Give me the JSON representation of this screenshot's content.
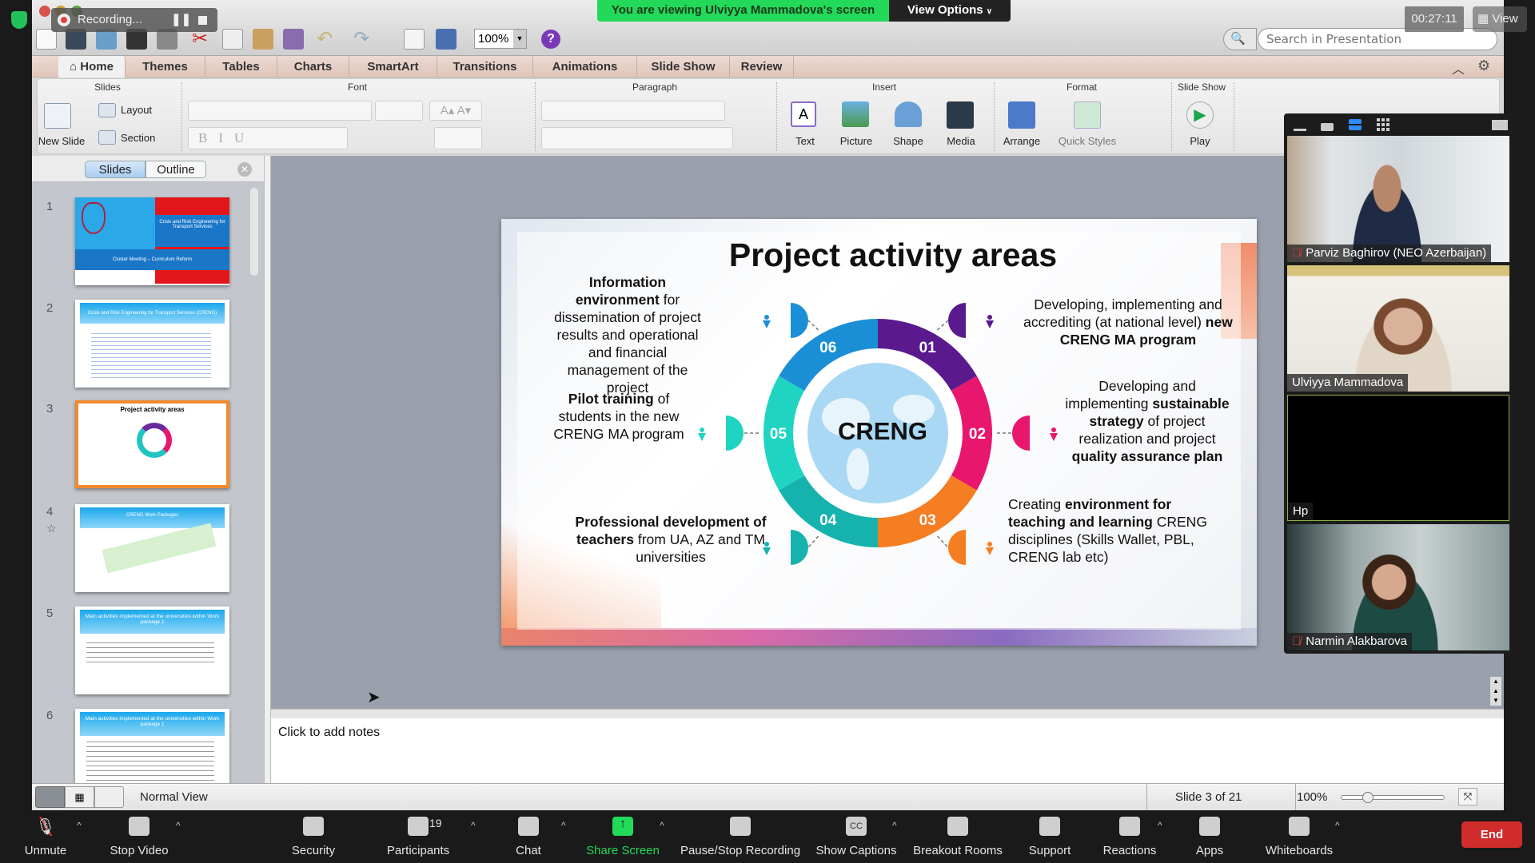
{
  "zoom_meeting": {
    "recording_label": "Recording...",
    "share_banner": "You are viewing Ulviyya Mammadova's screen",
    "view_options": "View Options",
    "timer": "00:27:11",
    "view_label": "View",
    "toolbar": [
      {
        "label": "Unmute",
        "icon": "microphone-muted-icon"
      },
      {
        "label": "Stop Video",
        "icon": "video-camera-icon"
      },
      {
        "label": "Security",
        "icon": "shield-icon"
      },
      {
        "label": "Participants",
        "icon": "participants-icon",
        "count": "19"
      },
      {
        "label": "Chat",
        "icon": "chat-bubble-icon"
      },
      {
        "label": "Share Screen",
        "icon": "share-screen-icon"
      },
      {
        "label": "Pause/Stop Recording",
        "icon": "pause-stop-icon"
      },
      {
        "label": "Show Captions",
        "icon": "cc-icon",
        "glyph": "CC"
      },
      {
        "label": "Breakout Rooms",
        "icon": "breakout-rooms-icon"
      },
      {
        "label": "Support",
        "icon": "support-icon"
      },
      {
        "label": "Reactions",
        "icon": "reactions-icon"
      },
      {
        "label": "Apps",
        "icon": "apps-icon"
      },
      {
        "label": "Whiteboards",
        "icon": "whiteboard-icon"
      }
    ],
    "end_label": "End",
    "share_color": "#23d959",
    "end_color": "#d12c2c",
    "participants": [
      {
        "name": "Parviz Baghirov (NEO Azerbaijan)",
        "muted": true
      },
      {
        "name": "Ulviyya Mammadova",
        "muted": false
      },
      {
        "name": "Hp",
        "muted": false
      },
      {
        "name": "Narmin Alakbarova",
        "muted": true
      }
    ]
  },
  "app": {
    "zoom_level": "100%",
    "search_placeholder": "Search in Presentation",
    "tabs": [
      "Home",
      "Themes",
      "Tables",
      "Charts",
      "SmartArt",
      "Transitions",
      "Animations",
      "Slide Show",
      "Review"
    ],
    "ribbon": {
      "groups": [
        "Slides",
        "Font",
        "Paragraph",
        "Insert",
        "Format",
        "Slide Show"
      ],
      "new_slide": "New Slide",
      "layout": "Layout",
      "section": "Section",
      "insert": [
        "Text",
        "Picture",
        "Shape",
        "Media"
      ],
      "format": [
        "Arrange",
        "Quick Styles"
      ],
      "play": "Play"
    },
    "panel_tabs": [
      "Slides",
      "Outline"
    ],
    "thumbnails": [
      {
        "num": "1",
        "title": "Crisis and Risk Engineering for Transport Services",
        "subtitle": "Cluster Meeting – Curriculum Reform"
      },
      {
        "num": "2",
        "title": "Crisis and Risk Engineering for Transport Services (CRENG)"
      },
      {
        "num": "3",
        "title": "Project activity areas"
      },
      {
        "num": "4",
        "title": "CRENG Work Packages"
      },
      {
        "num": "5",
        "title": "Main activities implemented at the universities within Work package 1"
      },
      {
        "num": "6",
        "title": "Main activities implemented at the universities within Work package 1"
      }
    ],
    "notes_placeholder": "Click to add notes",
    "status": {
      "view": "Normal View",
      "slide_info": "Slide 3 of 21",
      "zoom": "100%",
      "zoom_slider_fraction": 0.25
    }
  },
  "slide": {
    "title": "Project activity areas",
    "center": "CRENG",
    "segments": [
      {
        "num": "01",
        "color": "#5a1a8e"
      },
      {
        "num": "02",
        "color": "#e8166d"
      },
      {
        "num": "03",
        "color": "#f57d22"
      },
      {
        "num": "04",
        "color": "#16b3ae"
      },
      {
        "num": "05",
        "color": "#20d4c2"
      },
      {
        "num": "06",
        "color": "#1b8fd6"
      }
    ],
    "areas": {
      "a01": [
        "Developing, implementing and accrediting (at national level) ",
        "new CRENG MA program"
      ],
      "a02": [
        "Developing and implementing ",
        "sustainable strategy",
        " of project realization and project ",
        "quality assurance plan"
      ],
      "a03": [
        "Creating ",
        "environment for teaching and learning",
        " CRENG disciplines (Skills Wallet, PBL, CRENG lab etc)"
      ],
      "a04": [
        "Professional development of teachers",
        " from UA, AZ and TM universities"
      ],
      "a05": [
        "Pilot training",
        " of students in the new CRENG MA program"
      ],
      "a06": [
        "Information environment",
        " for dissemination of project results and operational and financial management of the project"
      ]
    }
  }
}
